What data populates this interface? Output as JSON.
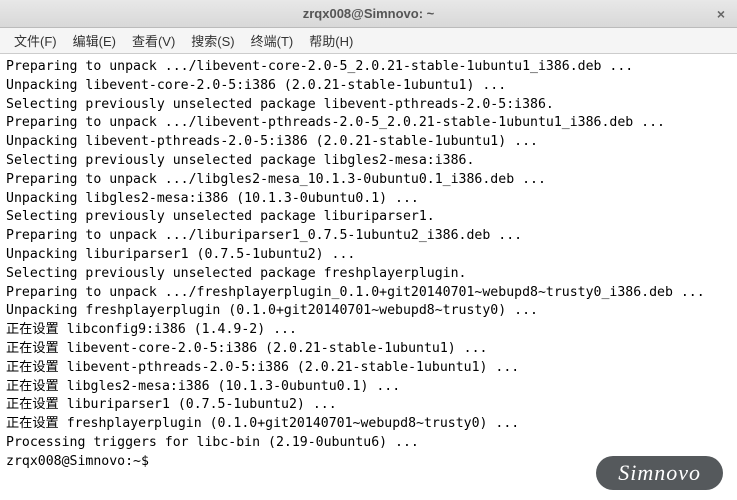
{
  "window": {
    "title": "zrqx008@Simnovo: ~",
    "close_label": "×"
  },
  "menu": {
    "file": "文件(F)",
    "edit": "编辑(E)",
    "view": "查看(V)",
    "search": "搜索(S)",
    "terminal": "终端(T)",
    "help": "帮助(H)"
  },
  "terminal": {
    "lines": [
      "Preparing to unpack .../libevent-core-2.0-5_2.0.21-stable-1ubuntu1_i386.deb ...",
      "Unpacking libevent-core-2.0-5:i386 (2.0.21-stable-1ubuntu1) ...",
      "Selecting previously unselected package libevent-pthreads-2.0-5:i386.",
      "Preparing to unpack .../libevent-pthreads-2.0-5_2.0.21-stable-1ubuntu1_i386.deb ...",
      "Unpacking libevent-pthreads-2.0-5:i386 (2.0.21-stable-1ubuntu1) ...",
      "Selecting previously unselected package libgles2-mesa:i386.",
      "Preparing to unpack .../libgles2-mesa_10.1.3-0ubuntu0.1_i386.deb ...",
      "Unpacking libgles2-mesa:i386 (10.1.3-0ubuntu0.1) ...",
      "Selecting previously unselected package liburiparser1.",
      "Preparing to unpack .../liburiparser1_0.7.5-1ubuntu2_i386.deb ...",
      "Unpacking liburiparser1 (0.7.5-1ubuntu2) ...",
      "Selecting previously unselected package freshplayerplugin.",
      "Preparing to unpack .../freshplayerplugin_0.1.0+git20140701~webupd8~trusty0_i386.deb ...",
      "Unpacking freshplayerplugin (0.1.0+git20140701~webupd8~trusty0) ...",
      "正在设置 libconfig9:i386 (1.4.9-2) ...",
      "正在设置 libevent-core-2.0-5:i386 (2.0.21-stable-1ubuntu1) ...",
      "正在设置 libevent-pthreads-2.0-5:i386 (2.0.21-stable-1ubuntu1) ...",
      "正在设置 libgles2-mesa:i386 (10.1.3-0ubuntu0.1) ...",
      "正在设置 liburiparser1 (0.7.5-1ubuntu2) ...",
      "正在设置 freshplayerplugin (0.1.0+git20140701~webupd8~trusty0) ...",
      "Processing triggers for libc-bin (2.19-0ubuntu6) ...",
      "zrqx008@Simnovo:~$ "
    ]
  },
  "watermark": {
    "text": "Simnovo"
  }
}
